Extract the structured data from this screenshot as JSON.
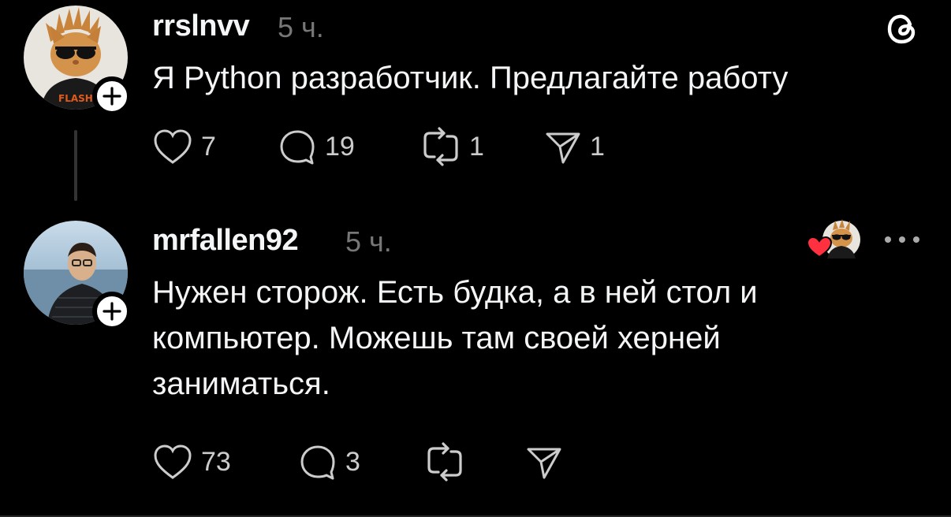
{
  "threads_icon": "threads-logo-icon",
  "posts": [
    {
      "username": "rrslnvv",
      "time": "5 ч.",
      "text": "Я Python разработчик. Предлагайте работу",
      "avatar": "cat-with-sunglasses-avatar",
      "actions": {
        "likes": "7",
        "replies": "19",
        "reposts": "1",
        "shares": "1"
      }
    },
    {
      "username": "mrfallen92",
      "time": "5 ч.",
      "text": "Нужен сторож. Есть будка, а в ней стол и\nкомпьютер. Можешь там своей херней\nзаниматься.",
      "avatar": "man-with-glasses-avatar",
      "liked_by_author": true,
      "actions": {
        "likes": "73",
        "replies": "3",
        "reposts": "",
        "shares": ""
      }
    }
  ],
  "colors": {
    "background": "#000000",
    "text": "#f3f5f7",
    "secondary": "#777777",
    "heart": "#ff3040"
  }
}
